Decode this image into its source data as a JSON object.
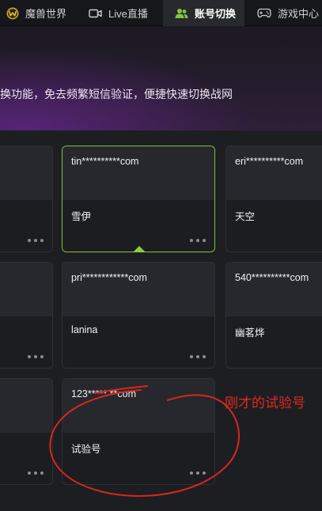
{
  "tabs": [
    {
      "label": "魔兽世界",
      "icon": "wow-logo-icon",
      "active": false
    },
    {
      "label": "Live直播",
      "icon": "video-camera-icon",
      "active": false
    },
    {
      "label": "账号切换",
      "icon": "users-icon",
      "active": true
    },
    {
      "label": "游戏中心",
      "icon": "gamepad-icon",
      "active": false
    }
  ],
  "banner": {
    "text": "换功能，免去频繁短信验证，便捷快速切换战网"
  },
  "accounts": [
    {
      "email": "",
      "nickname": ""
    },
    {
      "email": "tin**********com",
      "nickname": "雪伊",
      "selected": true
    },
    {
      "email": "eri**********com",
      "nickname": "天空"
    },
    {
      "email": "",
      "nickname": ""
    },
    {
      "email": "pri************com",
      "nickname": "lanina"
    },
    {
      "email": "540**********com",
      "nickname": "幽茗烨"
    },
    {
      "email": "",
      "nickname": ""
    },
    {
      "email": "123*****  **com",
      "nickname": "试验号"
    }
  ],
  "annotation": {
    "text": "刚才的试验号",
    "color": "#e0291d"
  },
  "colors": {
    "accent_selected": "#7fc13b",
    "background": "#1d1e22"
  }
}
